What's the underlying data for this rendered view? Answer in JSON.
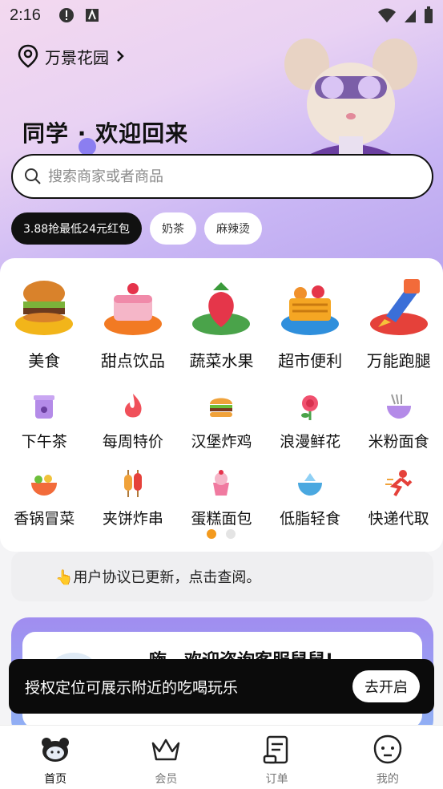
{
  "status_bar": {
    "time": "2:16"
  },
  "header": {
    "location": "万景花园",
    "welcome": "同学 · 欢迎回来"
  },
  "search": {
    "placeholder": "搜索商家或者商品"
  },
  "chips": [
    {
      "label": "3.88抢最低24元红包",
      "style": "dark"
    },
    {
      "label": "奶茶"
    },
    {
      "label": "麻辣烫"
    }
  ],
  "categories_big": [
    {
      "label": "美食",
      "icon": "burger-icon"
    },
    {
      "label": "甜点饮品",
      "icon": "cake-icon"
    },
    {
      "label": "蔬菜水果",
      "icon": "strawberry-icon"
    },
    {
      "label": "超市便利",
      "icon": "basket-icon"
    },
    {
      "label": "万能跑腿",
      "icon": "rocket-icon"
    }
  ],
  "categories_small": [
    {
      "label": "下午茶",
      "icon": "tea-cup-icon"
    },
    {
      "label": "每周特价",
      "icon": "flame-icon"
    },
    {
      "label": "汉堡炸鸡",
      "icon": "hamburger-icon"
    },
    {
      "label": "浪漫鲜花",
      "icon": "flower-icon"
    },
    {
      "label": "米粉面食",
      "icon": "noodle-bowl-icon"
    },
    {
      "label": "香锅冒菜",
      "icon": "hotpot-icon"
    },
    {
      "label": "夹饼炸串",
      "icon": "skewer-icon"
    },
    {
      "label": "蛋糕面包",
      "icon": "cake-cup-icon"
    },
    {
      "label": "低脂轻食",
      "icon": "salad-icon"
    },
    {
      "label": "快递代取",
      "icon": "courier-icon"
    }
  ],
  "notice": {
    "text": "👆用户协议已更新，点击查阅。"
  },
  "promo": {
    "title": "嗨，欢迎咨询客服鼠鼠!"
  },
  "toast": {
    "message": "授权定位可展示附近的吃喝玩乐",
    "action": "去开启"
  },
  "tabs": [
    {
      "label": "首页",
      "icon": "home-mascot-icon",
      "active": true
    },
    {
      "label": "会员",
      "icon": "crown-icon"
    },
    {
      "label": "订单",
      "icon": "order-icon"
    },
    {
      "label": "我的",
      "icon": "profile-icon"
    }
  ],
  "colors": {
    "accent": "#f39a1e",
    "dark": "#111111",
    "hero": "#c9b6f4"
  }
}
